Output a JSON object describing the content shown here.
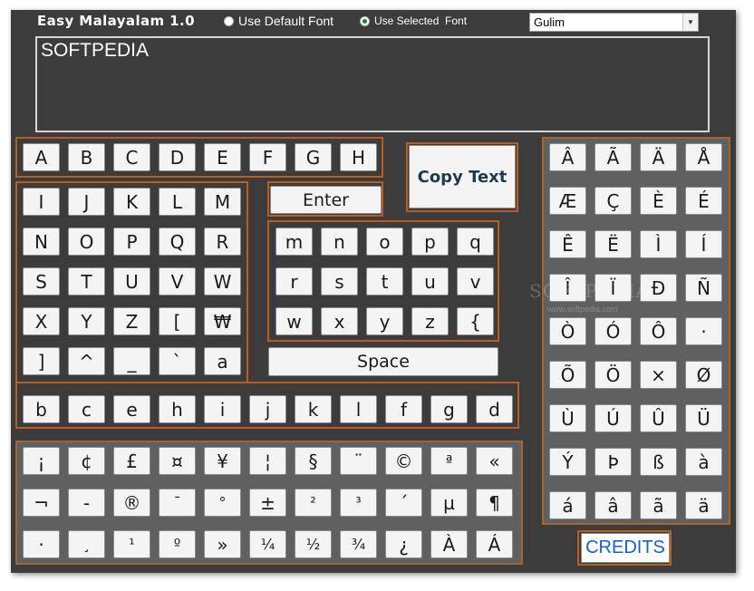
{
  "app": {
    "title": "Easy Malayalam 1.0",
    "font_options": [
      {
        "label": "Use Default Font",
        "checked": false
      },
      {
        "label": "Use Selected  Font",
        "checked": true
      }
    ],
    "font_select_value": "Gulim",
    "text_value": "SOFTPEDIA"
  },
  "buttons": {
    "copy": "Copy Text",
    "enter": "Enter",
    "space": "Space",
    "credits": "CREDITS"
  },
  "keys": {
    "upper_row1": [
      "A",
      "B",
      "C",
      "D",
      "E",
      "F",
      "G",
      "H"
    ],
    "left_block": [
      [
        "I",
        "J",
        "K",
        "L",
        "M"
      ],
      [
        "N",
        "O",
        "P",
        "Q",
        "R"
      ],
      [
        "S",
        "T",
        "U",
        "V",
        "W"
      ],
      [
        "X",
        "Y",
        "Z",
        "[",
        "₩"
      ],
      [
        "]",
        "^",
        "_",
        "`",
        "a"
      ]
    ],
    "lower_row": [
      "b",
      "c",
      "e",
      "h",
      "i",
      "j",
      "k",
      "l",
      "f",
      "g",
      "d"
    ],
    "mid_block": [
      [
        "m",
        "n",
        "o",
        "p",
        "q"
      ],
      [
        "r",
        "s",
        "t",
        "u",
        "v"
      ],
      [
        "w",
        "x",
        "y",
        "z",
        "{"
      ]
    ],
    "right_block": [
      [
        "Â",
        "Ã",
        "Ä",
        "Å"
      ],
      [
        "Æ",
        "Ç",
        "È",
        "É"
      ],
      [
        "Ê",
        "Ë",
        "Ì",
        "Í"
      ],
      [
        "Î",
        "Ï",
        "Ð",
        "Ñ"
      ],
      [
        "Ò",
        "Ó",
        "Ô",
        "·"
      ],
      [
        "Õ",
        "Ö",
        "×",
        "Ø"
      ],
      [
        "Ù",
        "Ú",
        "Û",
        "Ü"
      ],
      [
        "Ý",
        "Þ",
        "ß",
        "à"
      ],
      [
        "á",
        "â",
        "ã",
        "ä"
      ]
    ],
    "symbols": [
      [
        "¡",
        "¢",
        "£",
        "¤",
        "¥",
        "¦",
        "§",
        "¨",
        "©",
        "ª",
        "«"
      ],
      [
        "¬",
        "-",
        "®",
        "¯",
        "°",
        "±",
        "²",
        "³",
        "´",
        "µ",
        "¶"
      ],
      [
        "·",
        "¸",
        "¹",
        "º",
        "»",
        "¼",
        "½",
        "¾",
        "¿",
        "À",
        "Á"
      ]
    ]
  },
  "watermark": {
    "text": "SOFTPEDIA",
    "sub": "www.softpedia.com"
  }
}
